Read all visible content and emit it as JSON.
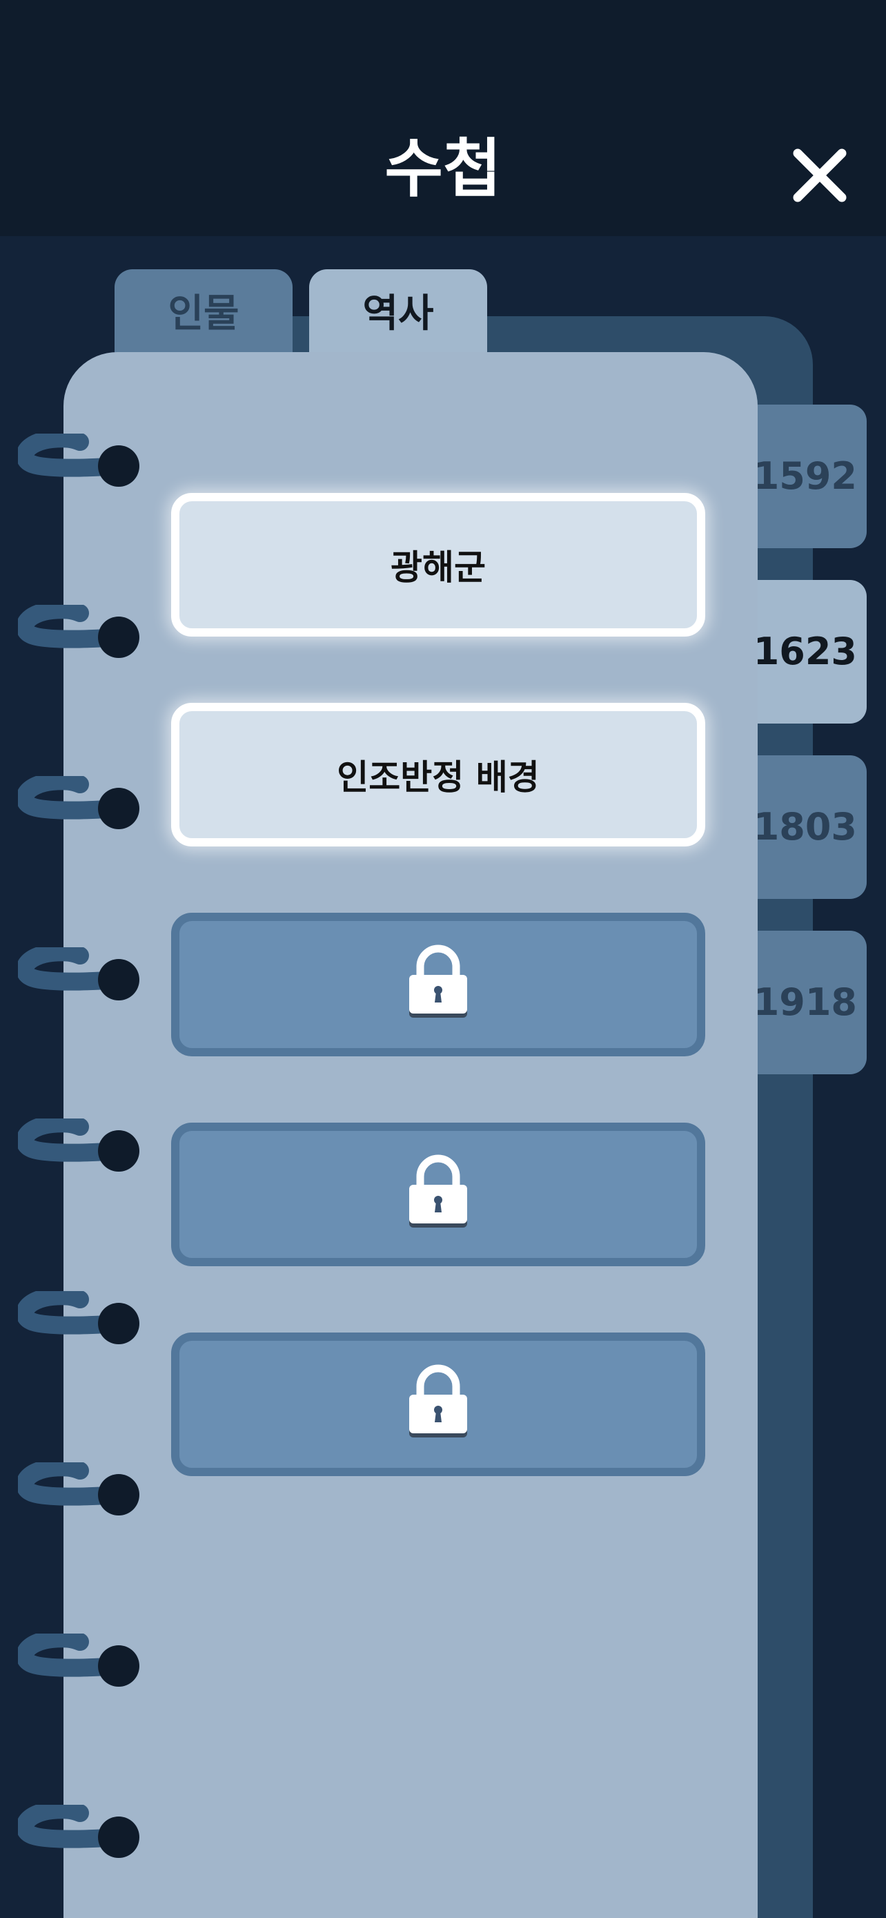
{
  "header": {
    "title": "수첩"
  },
  "icons": {
    "close": "close-icon",
    "lock": "lock-icon",
    "ring": "binder-ring"
  },
  "tabs": [
    {
      "label": "인물",
      "active": false
    },
    {
      "label": "역사",
      "active": true
    }
  ],
  "year_tabs": [
    {
      "label": "1592",
      "active": false
    },
    {
      "label": "1623",
      "active": true
    },
    {
      "label": "1803",
      "active": false
    },
    {
      "label": "1918",
      "active": false
    }
  ],
  "entries": [
    {
      "label": "광해군",
      "locked": false
    },
    {
      "label": "인조반정 배경",
      "locked": false
    },
    {
      "label": "",
      "locked": true
    },
    {
      "label": "",
      "locked": true
    },
    {
      "label": "",
      "locked": true
    }
  ],
  "colors": {
    "header_bg": "#0f1c2c",
    "screen_bg": "#132339",
    "page_bg": "#a2b6cb",
    "active_tab": "#a2b8cd",
    "inactive_tab": "#5b7c9b",
    "unlocked_entry": "#d4e0eb",
    "locked_entry": "#6a8fb3",
    "ring": "#35597b"
  }
}
